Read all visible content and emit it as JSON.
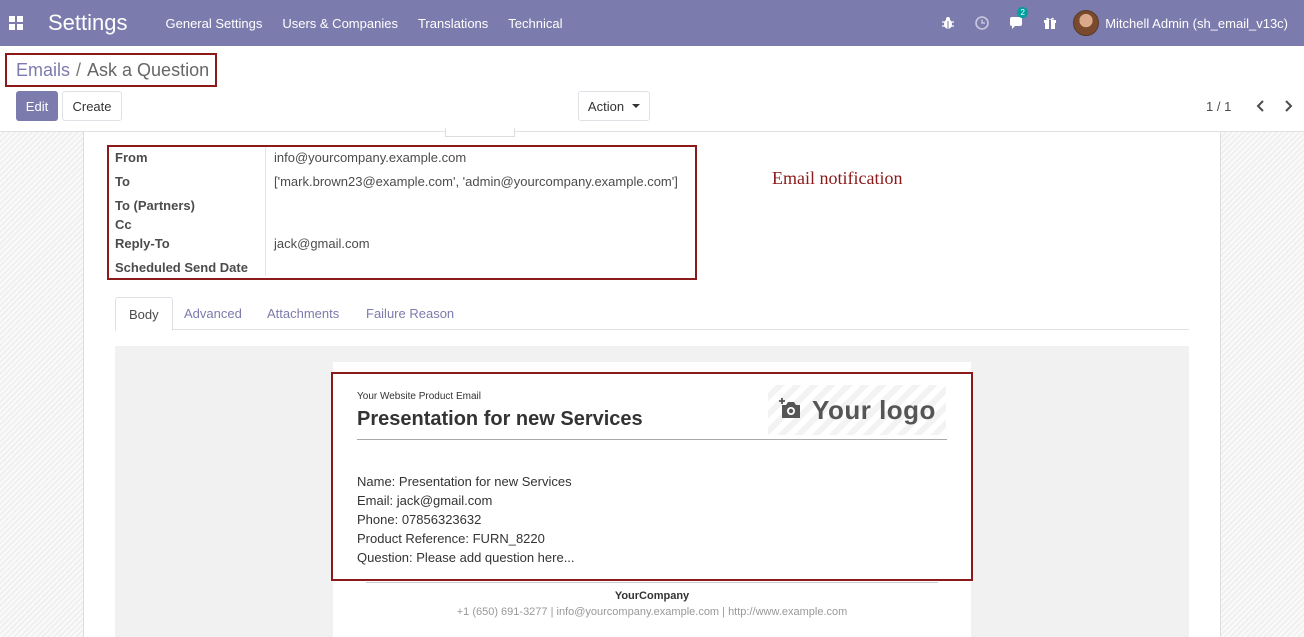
{
  "navbar": {
    "app_title": "Settings",
    "menu": [
      "General Settings",
      "Users & Companies",
      "Translations",
      "Technical"
    ],
    "chat_badge": "2",
    "user_name": "Mitchell Admin (sh_email_v13c)",
    "color": "#7c7bad"
  },
  "breadcrumb": {
    "parent": "Emails",
    "separator": "/",
    "current": "Ask a Question"
  },
  "buttons": {
    "edit": "Edit",
    "create": "Create",
    "action": "Action"
  },
  "pager": "1 / 1",
  "fields": [
    {
      "label": "From",
      "value": "info@yourcompany.example.com"
    },
    {
      "label": "To",
      "value": "['mark.brown23@example.com', 'admin@yourcompany.example.com']"
    },
    {
      "label": "To (Partners)",
      "value": ""
    },
    {
      "label": "Cc",
      "value": ""
    },
    {
      "label": "Reply-To",
      "value": "jack@gmail.com"
    },
    {
      "label": "Scheduled Send Date",
      "value": ""
    }
  ],
  "annotation": "Email notification",
  "tabs": [
    "Body",
    "Advanced",
    "Attachments",
    "Failure Reason"
  ],
  "email": {
    "small_header": "Your Website Product Email",
    "title": "Presentation for new Services",
    "logo_text": "Your logo",
    "lines": [
      "Name: Presentation for new Services",
      "Email: jack@gmail.com",
      "Phone: 07856323632",
      "Product Reference: FURN_8220",
      "Question: Please add question here..."
    ],
    "footer_company": "YourCompany",
    "footer_contact": "+1 (650) 691-3277 | info@yourcompany.example.com | http://www.example.com"
  },
  "colors": {
    "highlight_border": "#8b1a1a",
    "accent": "#7c7bad"
  }
}
